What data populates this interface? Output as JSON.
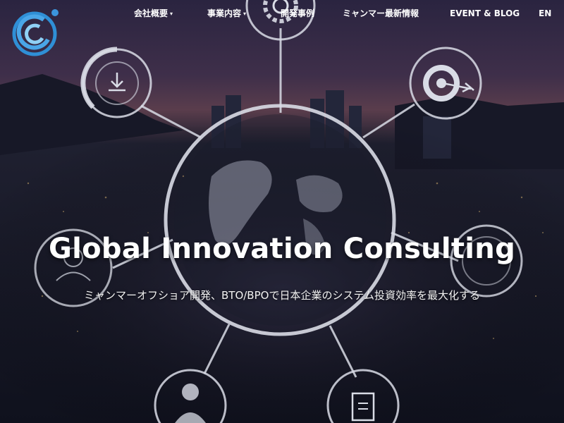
{
  "nav": {
    "items": [
      {
        "label": "会社概要",
        "has_dropdown": true
      },
      {
        "label": "事業内容",
        "has_dropdown": true
      },
      {
        "label": "開発事例",
        "has_dropdown": false
      },
      {
        "label": "ミャンマー最新情報",
        "has_dropdown": false
      },
      {
        "label": "EVENT & BLOG",
        "has_dropdown": false
      },
      {
        "label": "EN",
        "has_dropdown": false
      }
    ],
    "caret": "▾"
  },
  "hero": {
    "headline": "Global Innovation Consulting",
    "tagline": "ミャンマーオフショア開発、BTO/BPOで日本企業のシステム投資効率を最大化する"
  },
  "colors": {
    "background": "#141627",
    "logo_blue": "#2f8fd6",
    "ring": "#d9dce6"
  },
  "icons": [
    "logo-icon",
    "gear-icon",
    "download-icon",
    "target-icon",
    "user-icon",
    "person-icon",
    "document-icon",
    "globe-icon"
  ]
}
